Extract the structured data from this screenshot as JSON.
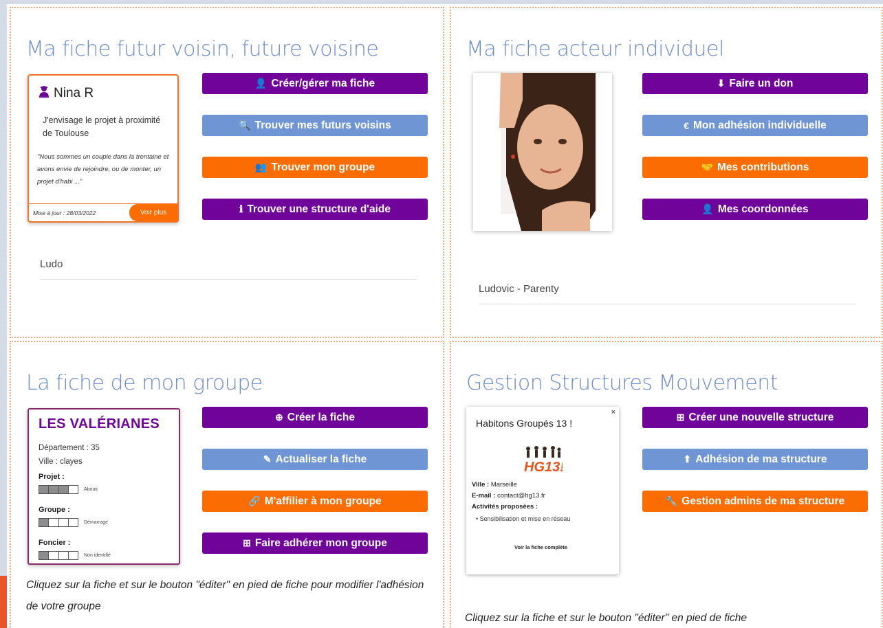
{
  "panels": {
    "neighbor": {
      "title": "Ma fiche futur voisin, future voisine",
      "card": {
        "icon": "user-female-icon",
        "name": "Nina R",
        "text": "J'envisage le projet à proximité de Toulouse",
        "quote": "\"Nous sommes un couple dans la trentaine et avons envie de rejoindre, ou de monter, un projet d'habi ...\"",
        "date": "Mise à jour : 28/03/2022",
        "more": "Voir plus"
      },
      "buttons": [
        {
          "label": "Créer/gérer ma fiche",
          "icon": "user-edit-icon",
          "glyph": "👤",
          "color": "purple"
        },
        {
          "label": "Trouver mes futurs voisins",
          "icon": "search-icon",
          "glyph": "🔍",
          "color": "blue"
        },
        {
          "label": "Trouver mon groupe",
          "icon": "users-icon",
          "glyph": "👥",
          "color": "orange"
        },
        {
          "label": "Trouver une structure d'aide",
          "icon": "info-circle-icon",
          "glyph": "ℹ",
          "color": "purple"
        }
      ],
      "user": "Ludo"
    },
    "actor": {
      "title": "Ma fiche acteur individuel",
      "buttons": [
        {
          "label": "Faire un don",
          "icon": "donate-icon",
          "glyph": "⬇",
          "color": "purple"
        },
        {
          "label": "Mon adhésion individuelle",
          "icon": "euro-icon",
          "glyph": "€",
          "color": "blue"
        },
        {
          "label": "Mes contributions",
          "icon": "handshake-icon",
          "glyph": "🤝",
          "color": "orange"
        },
        {
          "label": "Mes coordonnées",
          "icon": "user-edit-icon",
          "glyph": "👤",
          "color": "purple"
        }
      ],
      "user": "Ludovic - Parenty"
    },
    "group": {
      "title": "La fiche de mon groupe",
      "card": {
        "name": "LES VALÉRIANES",
        "department": "Département : 35",
        "city": "Ville : clayes",
        "project_label": "Projet :",
        "project_note": "Abouti",
        "project_level": 3,
        "group_label": "Groupe :",
        "group_note": "Démarrage",
        "group_level": 1,
        "land_label": "Foncier :",
        "land_note": "Non identifié",
        "land_level": 1
      },
      "buttons": [
        {
          "label": "Créer la fiche",
          "icon": "plus-circle-icon",
          "glyph": "⊕",
          "color": "purple"
        },
        {
          "label": "Actualiser la fiche",
          "icon": "edit-icon",
          "glyph": "✎",
          "color": "blue"
        },
        {
          "label": "M'affilier à mon groupe",
          "icon": "link-icon",
          "glyph": "🔗",
          "color": "orange"
        },
        {
          "label": "Faire adhérer mon groupe",
          "icon": "calendar-plus-icon",
          "glyph": "⊞",
          "color": "purple"
        }
      ],
      "help": "Cliquez sur la fiche et sur le bouton \"éditer\" en pied de fiche pour modifier l'adhésion de votre groupe"
    },
    "structures": {
      "title": "Gestion Structures Mouvement",
      "card": {
        "close": "×",
        "name": "Habitons Groupés 13 !",
        "logo_text": "HG13!",
        "city_label": "Ville :",
        "city": "Marseille",
        "email_label": "E-mail :",
        "email": "contact@hg13.fr",
        "activities_label": "Activités proposées :",
        "activity": "Sensibilisation et mise en réseau",
        "link": "Voir la fiche complète"
      },
      "buttons": [
        {
          "label": "Créer une nouvelle structure",
          "icon": "plus-square-icon",
          "glyph": "⊞",
          "color": "purple"
        },
        {
          "label": "Adhésion de ma structure",
          "icon": "arrow-up-icon",
          "glyph": "⬆",
          "color": "blue"
        },
        {
          "label": "Gestion admins de ma structure",
          "icon": "wrench-icon",
          "glyph": "🔧",
          "color": "orange"
        }
      ],
      "help": "Cliquez sur la fiche et sur le bouton \"éditer\" en pied de fiche"
    }
  },
  "colors": {
    "purple": "#70039a",
    "blue": "#6f95d4",
    "orange": "#fb6c02",
    "title": "#6a8ccb",
    "border": "#f5a679"
  }
}
